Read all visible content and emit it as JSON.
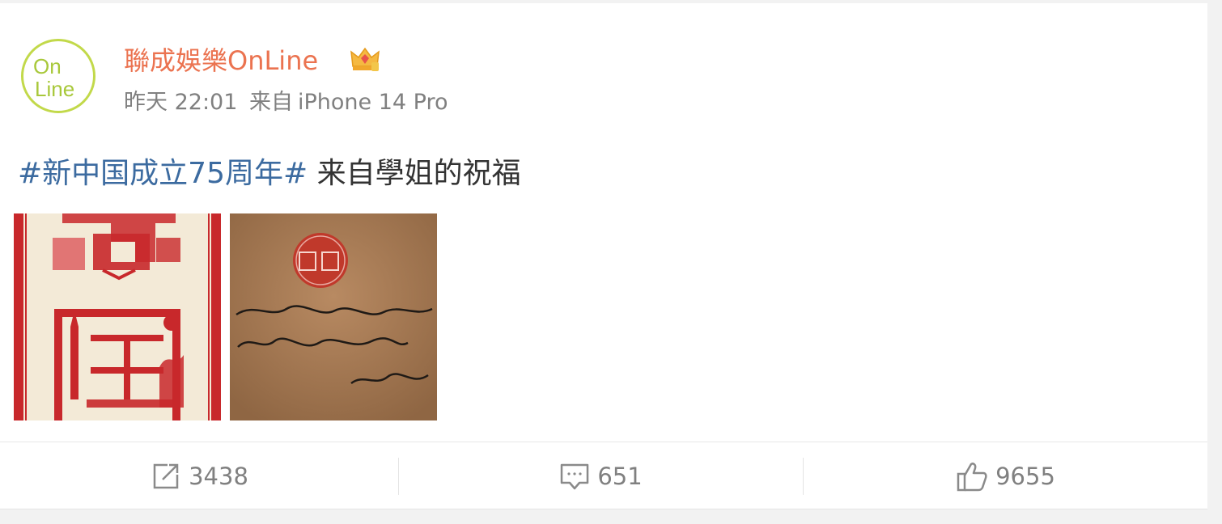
{
  "post": {
    "author": {
      "name": "聯成娛樂OnLine",
      "avatar_icon": "online-logo-avatar",
      "badge_icon": "crown-badge-icon"
    },
    "meta": {
      "time": "昨天 22:01",
      "source_prefix": "来自",
      "source": "iPhone 14 Pro"
    },
    "topic": "#新中国成立75周年#",
    "text": " 来自學姐的祝福",
    "images": [
      {
        "name": "papercut-image",
        "icon": "paper-cut-art-image"
      },
      {
        "name": "handwritten-note-image",
        "icon": "blessing-note-image"
      }
    ]
  },
  "actions": {
    "repost": {
      "icon": "repost-icon",
      "count": "3438"
    },
    "comment": {
      "icon": "comment-icon",
      "count": "651"
    },
    "like": {
      "icon": "like-icon",
      "count": "9655"
    }
  },
  "colors": {
    "author_name": "#eb7350",
    "topic": "#3c6ba0",
    "meta": "#808080",
    "avatar_ring": "#c2d94a",
    "papercut_red": "#c8282b",
    "note_paper": "#a57a55"
  }
}
